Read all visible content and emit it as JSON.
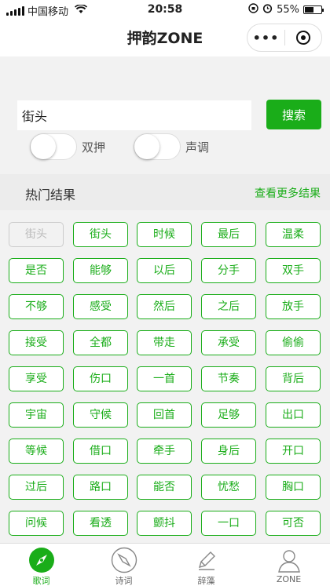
{
  "status": {
    "carrier": "中国移动",
    "time": "20:58",
    "battery": "55%",
    "battery_level": 0.55
  },
  "nav": {
    "title": "押韵ZONE",
    "more": "•••"
  },
  "search": {
    "value": "街头",
    "button": "搜索"
  },
  "toggles": [
    {
      "label": "双押"
    },
    {
      "label": "声调"
    }
  ],
  "hot": {
    "title": "热门结果",
    "more": "查看更多结果",
    "items": [
      "街头",
      "街头",
      "时候",
      "最后",
      "温柔",
      "是否",
      "能够",
      "以后",
      "分手",
      "双手",
      "不够",
      "感受",
      "然后",
      "之后",
      "放手",
      "接受",
      "全都",
      "带走",
      "承受",
      "偷偷",
      "享受",
      "伤口",
      "一首",
      "节奏",
      "背后",
      "宇宙",
      "守候",
      "回首",
      "足够",
      "出口",
      "等候",
      "借口",
      "牵手",
      "身后",
      "开口",
      "过后",
      "路口",
      "能否",
      "忧愁",
      "胸口",
      "问候",
      "看透",
      "颤抖",
      "一口",
      "可否"
    ]
  },
  "tabs": [
    {
      "label": "歌词",
      "icon": "compass-filled-icon"
    },
    {
      "label": "诗词",
      "icon": "compass-outline-icon"
    },
    {
      "label": "辞藻",
      "icon": "pen-icon"
    },
    {
      "label": "ZONE",
      "icon": "user-icon"
    }
  ],
  "colors": {
    "accent": "#1aad19"
  }
}
